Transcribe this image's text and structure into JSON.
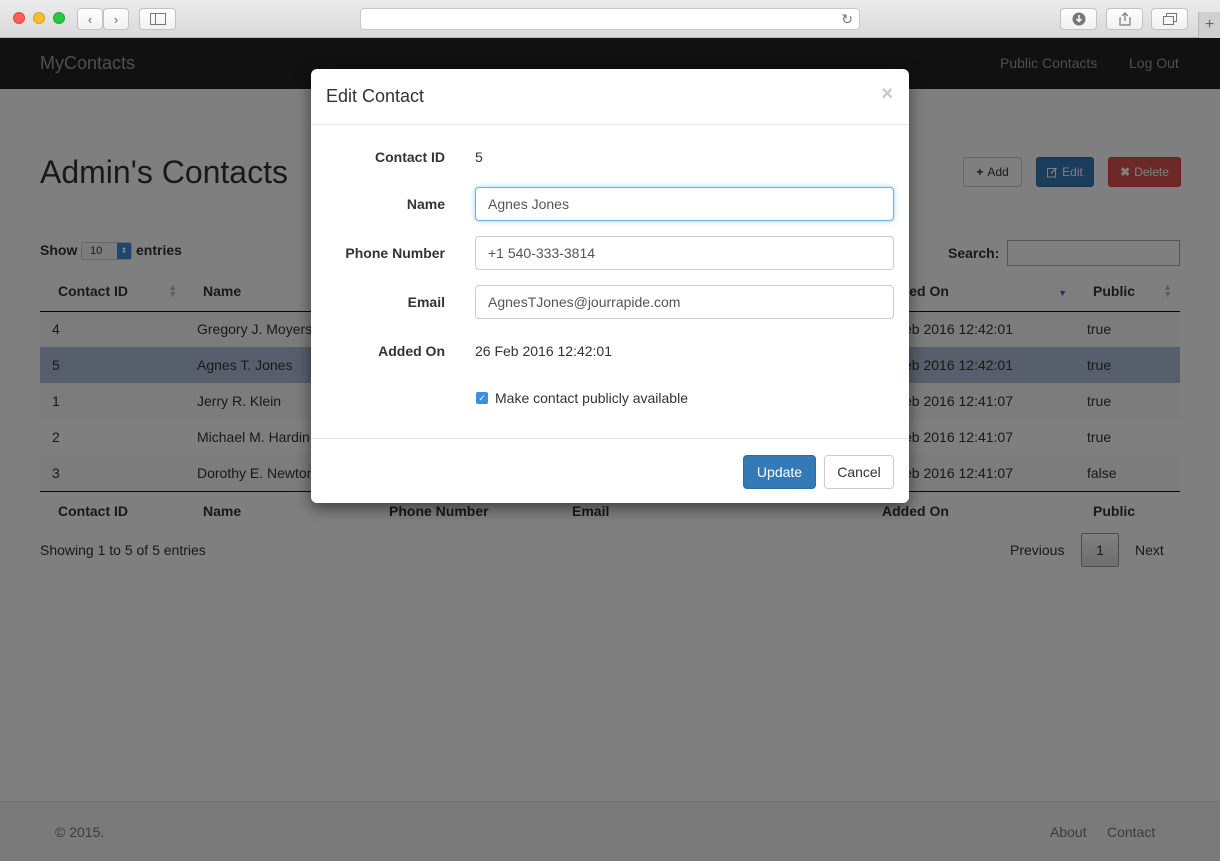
{
  "navbar": {
    "brand": "MyContacts",
    "links": [
      "Public Contacts",
      "Log Out"
    ]
  },
  "page": {
    "title": "Admin's Contacts",
    "buttons": {
      "add": "Add",
      "edit": "Edit",
      "delete": "Delete"
    },
    "show_label": "Show",
    "show_value": "10",
    "entries_label": "entries",
    "search_label": "Search:",
    "search_value": ""
  },
  "table": {
    "headers": [
      "Contact ID",
      "Name",
      "Phone Number",
      "Email",
      "Added On",
      "Public"
    ],
    "rows": [
      {
        "id": "4",
        "name": "Gregory J. Moyers",
        "added": "26 Feb 2016 12:42:01",
        "public": "true"
      },
      {
        "id": "5",
        "name": "Agnes T. Jones",
        "added": "26 Feb 2016 12:42:01",
        "public": "true"
      },
      {
        "id": "1",
        "name": "Jerry R. Klein",
        "added": "26 Feb 2016 12:41:07",
        "public": "true"
      },
      {
        "id": "2",
        "name": "Michael M. Hardin",
        "added": "26 Feb 2016 12:41:07",
        "public": "true"
      },
      {
        "id": "3",
        "name": "Dorothy E. Newton",
        "added": "26 Feb 2016 12:41:07",
        "public": "false"
      }
    ],
    "info": "Showing 1 to 5 of 5 entries",
    "pager": {
      "previous": "Previous",
      "page": "1",
      "next": "Next"
    }
  },
  "footer": {
    "copyright": "© 2015.",
    "links": [
      "About",
      "Contact"
    ]
  },
  "modal": {
    "title": "Edit Contact",
    "close": "×",
    "fields": {
      "contact_id_label": "Contact ID",
      "contact_id_value": "5",
      "name_label": "Name",
      "name_value": "Agnes Jones",
      "phone_label": "Phone Number",
      "phone_value": "+1 540-333-3814",
      "email_label": "Email",
      "email_value": "AgnesTJones@jourrapide.com",
      "added_label": "Added On",
      "added_value": "26 Feb 2016 12:42:01",
      "public_label": "Make contact publicly available",
      "public_checked": true
    },
    "buttons": {
      "update": "Update",
      "cancel": "Cancel"
    }
  }
}
